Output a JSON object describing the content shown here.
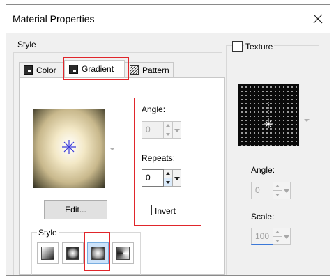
{
  "window": {
    "title": "Material Properties"
  },
  "style_group": {
    "label": "Style",
    "tabs": [
      {
        "label": "Color",
        "icon": "color-icon"
      },
      {
        "label": "Gradient",
        "icon": "gradient-icon"
      },
      {
        "label": "Pattern",
        "icon": "pattern-icon"
      }
    ],
    "active_tab": "Gradient"
  },
  "gradient": {
    "edit_label": "Edit...",
    "angle": {
      "label": "Angle:",
      "value": "0",
      "enabled": false
    },
    "repeats": {
      "label": "Repeats:",
      "value": "0",
      "enabled": true
    },
    "invert": {
      "label": "Invert",
      "checked": false
    },
    "style": {
      "label": "Style",
      "options": [
        "linear",
        "rectangular",
        "sunburst",
        "radial"
      ],
      "selected": "sunburst"
    }
  },
  "texture_group": {
    "label": "Texture",
    "checked": false,
    "angle": {
      "label": "Angle:",
      "value": "0",
      "enabled": false
    },
    "scale": {
      "label": "Scale:",
      "value": "100",
      "enabled": false
    }
  },
  "colors": {
    "highlight": "#e0262b",
    "center_marker": "#3a3ad8",
    "scale_focus": "#3b78d8"
  }
}
